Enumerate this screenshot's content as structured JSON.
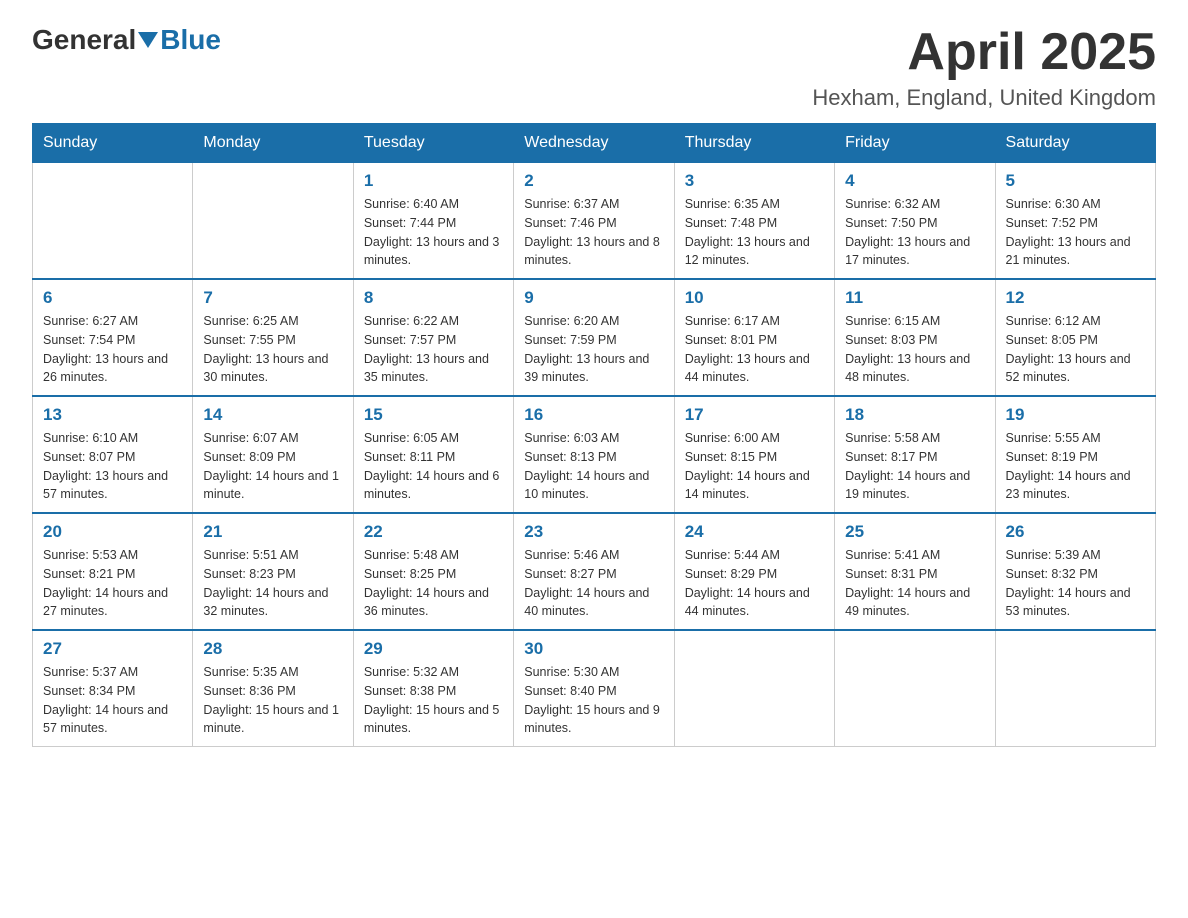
{
  "header": {
    "logo_general": "General",
    "logo_blue": "Blue",
    "title": "April 2025",
    "subtitle": "Hexham, England, United Kingdom"
  },
  "calendar": {
    "days_of_week": [
      "Sunday",
      "Monday",
      "Tuesday",
      "Wednesday",
      "Thursday",
      "Friday",
      "Saturday"
    ],
    "weeks": [
      [
        {
          "day": "",
          "info": ""
        },
        {
          "day": "",
          "info": ""
        },
        {
          "day": "1",
          "info": "Sunrise: 6:40 AM\nSunset: 7:44 PM\nDaylight: 13 hours\nand 3 minutes."
        },
        {
          "day": "2",
          "info": "Sunrise: 6:37 AM\nSunset: 7:46 PM\nDaylight: 13 hours\nand 8 minutes."
        },
        {
          "day": "3",
          "info": "Sunrise: 6:35 AM\nSunset: 7:48 PM\nDaylight: 13 hours\nand 12 minutes."
        },
        {
          "day": "4",
          "info": "Sunrise: 6:32 AM\nSunset: 7:50 PM\nDaylight: 13 hours\nand 17 minutes."
        },
        {
          "day": "5",
          "info": "Sunrise: 6:30 AM\nSunset: 7:52 PM\nDaylight: 13 hours\nand 21 minutes."
        }
      ],
      [
        {
          "day": "6",
          "info": "Sunrise: 6:27 AM\nSunset: 7:54 PM\nDaylight: 13 hours\nand 26 minutes."
        },
        {
          "day": "7",
          "info": "Sunrise: 6:25 AM\nSunset: 7:55 PM\nDaylight: 13 hours\nand 30 minutes."
        },
        {
          "day": "8",
          "info": "Sunrise: 6:22 AM\nSunset: 7:57 PM\nDaylight: 13 hours\nand 35 minutes."
        },
        {
          "day": "9",
          "info": "Sunrise: 6:20 AM\nSunset: 7:59 PM\nDaylight: 13 hours\nand 39 minutes."
        },
        {
          "day": "10",
          "info": "Sunrise: 6:17 AM\nSunset: 8:01 PM\nDaylight: 13 hours\nand 44 minutes."
        },
        {
          "day": "11",
          "info": "Sunrise: 6:15 AM\nSunset: 8:03 PM\nDaylight: 13 hours\nand 48 minutes."
        },
        {
          "day": "12",
          "info": "Sunrise: 6:12 AM\nSunset: 8:05 PM\nDaylight: 13 hours\nand 52 minutes."
        }
      ],
      [
        {
          "day": "13",
          "info": "Sunrise: 6:10 AM\nSunset: 8:07 PM\nDaylight: 13 hours\nand 57 minutes."
        },
        {
          "day": "14",
          "info": "Sunrise: 6:07 AM\nSunset: 8:09 PM\nDaylight: 14 hours\nand 1 minute."
        },
        {
          "day": "15",
          "info": "Sunrise: 6:05 AM\nSunset: 8:11 PM\nDaylight: 14 hours\nand 6 minutes."
        },
        {
          "day": "16",
          "info": "Sunrise: 6:03 AM\nSunset: 8:13 PM\nDaylight: 14 hours\nand 10 minutes."
        },
        {
          "day": "17",
          "info": "Sunrise: 6:00 AM\nSunset: 8:15 PM\nDaylight: 14 hours\nand 14 minutes."
        },
        {
          "day": "18",
          "info": "Sunrise: 5:58 AM\nSunset: 8:17 PM\nDaylight: 14 hours\nand 19 minutes."
        },
        {
          "day": "19",
          "info": "Sunrise: 5:55 AM\nSunset: 8:19 PM\nDaylight: 14 hours\nand 23 minutes."
        }
      ],
      [
        {
          "day": "20",
          "info": "Sunrise: 5:53 AM\nSunset: 8:21 PM\nDaylight: 14 hours\nand 27 minutes."
        },
        {
          "day": "21",
          "info": "Sunrise: 5:51 AM\nSunset: 8:23 PM\nDaylight: 14 hours\nand 32 minutes."
        },
        {
          "day": "22",
          "info": "Sunrise: 5:48 AM\nSunset: 8:25 PM\nDaylight: 14 hours\nand 36 minutes."
        },
        {
          "day": "23",
          "info": "Sunrise: 5:46 AM\nSunset: 8:27 PM\nDaylight: 14 hours\nand 40 minutes."
        },
        {
          "day": "24",
          "info": "Sunrise: 5:44 AM\nSunset: 8:29 PM\nDaylight: 14 hours\nand 44 minutes."
        },
        {
          "day": "25",
          "info": "Sunrise: 5:41 AM\nSunset: 8:31 PM\nDaylight: 14 hours\nand 49 minutes."
        },
        {
          "day": "26",
          "info": "Sunrise: 5:39 AM\nSunset: 8:32 PM\nDaylight: 14 hours\nand 53 minutes."
        }
      ],
      [
        {
          "day": "27",
          "info": "Sunrise: 5:37 AM\nSunset: 8:34 PM\nDaylight: 14 hours\nand 57 minutes."
        },
        {
          "day": "28",
          "info": "Sunrise: 5:35 AM\nSunset: 8:36 PM\nDaylight: 15 hours\nand 1 minute."
        },
        {
          "day": "29",
          "info": "Sunrise: 5:32 AM\nSunset: 8:38 PM\nDaylight: 15 hours\nand 5 minutes."
        },
        {
          "day": "30",
          "info": "Sunrise: 5:30 AM\nSunset: 8:40 PM\nDaylight: 15 hours\nand 9 minutes."
        },
        {
          "day": "",
          "info": ""
        },
        {
          "day": "",
          "info": ""
        },
        {
          "day": "",
          "info": ""
        }
      ]
    ]
  }
}
